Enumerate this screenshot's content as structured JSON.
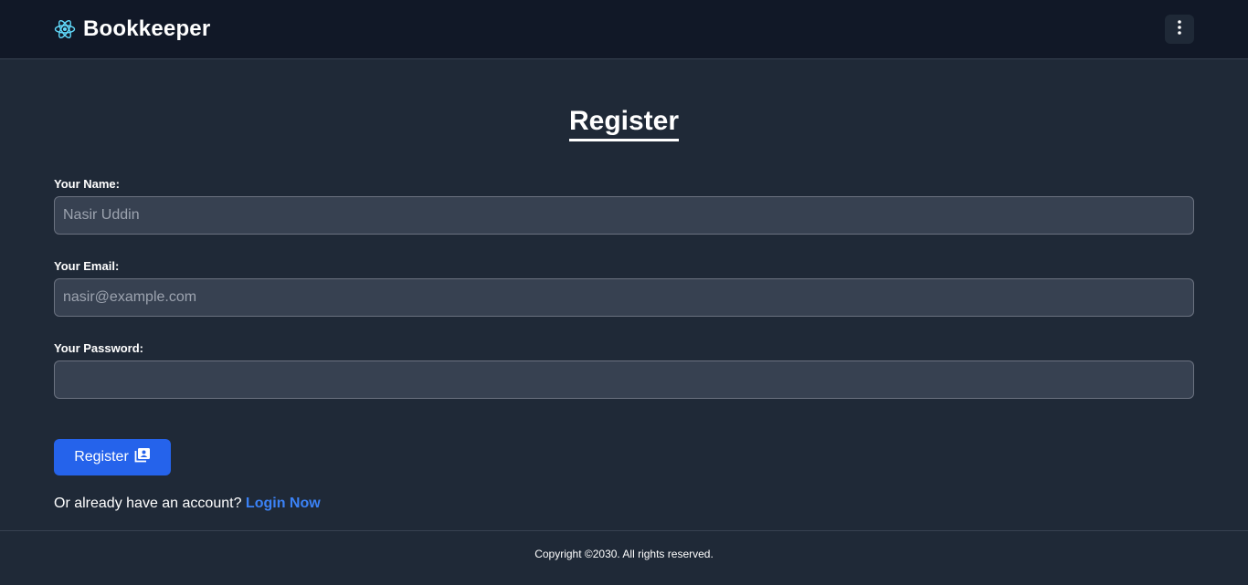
{
  "header": {
    "brand_name": "Bookkeeper",
    "brand_icon": "react-atom-icon",
    "menu_icon": "kebab-menu-icon"
  },
  "main": {
    "title": "Register",
    "fields": {
      "name": {
        "label": "Your Name:",
        "placeholder": "Nasir Uddin",
        "value": ""
      },
      "email": {
        "label": "Your Email:",
        "placeholder": "nasir@example.com",
        "value": ""
      },
      "password": {
        "label": "Your Password:",
        "placeholder": "",
        "value": ""
      }
    },
    "submit_label": "Register",
    "submit_icon": "contact-card-icon",
    "login_prompt": "Or already have an account?",
    "login_link": "Login Now"
  },
  "footer": {
    "copyright": "Copyright ©2030. All rights reserved."
  },
  "colors": {
    "header_bg": "#111827",
    "page_bg": "#1f2937",
    "input_bg": "#374151",
    "accent": "#2563eb",
    "link": "#3b82f6",
    "brand_icon": "#61dafb"
  }
}
